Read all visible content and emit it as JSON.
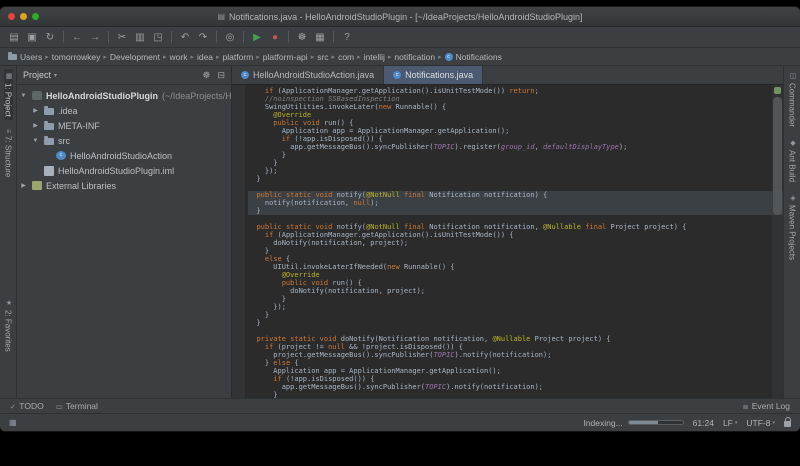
{
  "window": {
    "title": "Notifications.java - HelloAndroidStudioPlugin - [~/IdeaProjects/HelloAndroidStudioPlugin]",
    "doc_icon_glyph": "▤"
  },
  "colors": {
    "keyword": "#cc7832",
    "annotation": "#bbb529",
    "comment": "#808080",
    "field": "#9876aa",
    "text": "#a9b7c6",
    "active_tab": "#4b5a70",
    "editor_bg": "#2b2b2b"
  },
  "toolbar": {
    "items": [
      {
        "name": "open-icon",
        "glyph": "▤"
      },
      {
        "name": "save-all-icon",
        "glyph": "▣"
      },
      {
        "name": "synchronize-icon",
        "glyph": "↻"
      },
      {
        "sep": true
      },
      {
        "name": "back-icon",
        "glyph": "←"
      },
      {
        "name": "forward-icon",
        "glyph": "→"
      },
      {
        "sep": true
      },
      {
        "name": "cut-icon",
        "glyph": "✂"
      },
      {
        "name": "copy-icon",
        "glyph": "▥"
      },
      {
        "name": "paste-icon",
        "glyph": "◳"
      },
      {
        "sep": true
      },
      {
        "name": "undo-icon",
        "glyph": "↶"
      },
      {
        "name": "redo-icon",
        "glyph": "↷"
      },
      {
        "sep": true
      },
      {
        "name": "find-icon",
        "glyph": "◎"
      },
      {
        "sep": true
      },
      {
        "name": "run-icon",
        "glyph": "▶",
        "color": "#499c54"
      },
      {
        "name": "debug-icon",
        "glyph": "●",
        "color": "#c75450"
      },
      {
        "sep": true
      },
      {
        "name": "settings-icon",
        "glyph": "☸"
      },
      {
        "name": "project-structure-icon",
        "glyph": "▦"
      },
      {
        "sep": true
      },
      {
        "name": "help-icon",
        "glyph": "?"
      }
    ]
  },
  "navbar": {
    "separator": "▸",
    "crumbs": [
      "Users",
      "tomorrowkey",
      "Development",
      "work",
      "idea",
      "platform",
      "platform-api",
      "src",
      "com",
      "intellij",
      "notification",
      "Notifications"
    ]
  },
  "tabs": [
    {
      "label": "HelloAndroidStudioAction.java",
      "active": false
    },
    {
      "label": "Notifications.java",
      "active": true
    }
  ],
  "left_stripe": [
    {
      "name": "tool-button-project",
      "label": "1: Project",
      "glyph": "▦",
      "active": true
    },
    {
      "name": "tool-button-structure",
      "label": "7: Structure",
      "glyph": "≡"
    },
    {
      "name": "tool-button-favorites",
      "label": "2: Favorites",
      "glyph": "★",
      "gap_before": 110
    }
  ],
  "right_stripe": [
    {
      "name": "tool-button-commander",
      "label": "Commander",
      "glyph": "◫"
    },
    {
      "name": "tool-button-ant-build",
      "label": "Ant Build",
      "glyph": "◆"
    },
    {
      "name": "tool-button-maven-projects",
      "label": "Maven Projects",
      "glyph": "◈"
    }
  ],
  "project_panel": {
    "header": "Project",
    "header_caret": "▾",
    "header_icons": [
      {
        "name": "gear-icon",
        "glyph": "☸"
      },
      {
        "name": "collapse-all-icon",
        "glyph": "⊟"
      }
    ],
    "tree": [
      {
        "level": 0,
        "chevron": "▼",
        "icon": "project",
        "label": "HelloAndroidStudioPlugin",
        "suffix": " (~/IdeaProjects/Hello",
        "bold": true
      },
      {
        "level": 1,
        "chevron": "▶",
        "icon": "folder",
        "label": ".idea"
      },
      {
        "level": 1,
        "chevron": "▶",
        "icon": "folder",
        "label": "META-INF"
      },
      {
        "level": 1,
        "chevron": "▼",
        "icon": "folder",
        "label": "src"
      },
      {
        "level": 2,
        "chevron": "",
        "icon": "class",
        "label": "HelloAndroidStudioAction"
      },
      {
        "level": 1,
        "chevron": "",
        "icon": "file",
        "label": "HelloAndroidStudioPlugin.iml"
      },
      {
        "level": 0,
        "chevron": "▶",
        "icon": "library",
        "label": "External Libraries"
      }
    ]
  },
  "bottom_stripe": {
    "left": [
      {
        "name": "tool-button-todo",
        "icon_name": "todo-icon",
        "glyph": "✓",
        "label": "TODO"
      },
      {
        "name": "tool-button-terminal",
        "icon_name": "terminal-icon",
        "glyph": "▭",
        "label": "Terminal"
      }
    ],
    "right": [
      {
        "name": "tool-button-event-log",
        "icon_name": "event-log-icon",
        "glyph": "≣",
        "label": "Event Log"
      }
    ]
  },
  "status_bar": {
    "quick_access_glyph": "▦",
    "indexing_label": "Indexing...",
    "progress_percent": 55,
    "caret_position": "61:24",
    "line_ending": "LF",
    "encoding": "UTF-8",
    "caret_glyph": "▾"
  },
  "editor": {
    "lines": [
      {
        "t": [
          [
            "d",
            "    "
          ],
          [
            "k",
            "if"
          ],
          [
            "d",
            " (ApplicationManager.getApplication().isUnitTestMode()) "
          ],
          [
            "k",
            "return"
          ],
          [
            "d",
            ";"
          ]
        ]
      },
      {
        "t": [
          [
            "c",
            "    //noinspection SSBasedInspection"
          ]
        ]
      },
      {
        "t": [
          [
            "d",
            "    SwingUtilities.invokeLater("
          ],
          [
            "k",
            "new"
          ],
          [
            "d",
            " Runnable() {"
          ]
        ]
      },
      {
        "t": [
          [
            "d",
            "      "
          ],
          [
            "a",
            "@Override"
          ]
        ]
      },
      {
        "t": [
          [
            "d",
            "      "
          ],
          [
            "k",
            "public"
          ],
          [
            "d",
            " "
          ],
          [
            "k",
            "void"
          ],
          [
            "d",
            " run() {"
          ]
        ]
      },
      {
        "t": [
          [
            "d",
            "        Application app = ApplicationManager.getApplication();"
          ]
        ]
      },
      {
        "t": [
          [
            "d",
            "        "
          ],
          [
            "k",
            "if"
          ],
          [
            "d",
            " (!app.isDisposed()) {"
          ]
        ]
      },
      {
        "t": [
          [
            "d",
            "          app.getMessageBus().syncPublisher("
          ],
          [
            "f",
            "TOPIC"
          ],
          [
            "d",
            ").register("
          ],
          [
            "f",
            "group_id"
          ],
          [
            "d",
            ", "
          ],
          [
            "f",
            "defaultDisplayType"
          ],
          [
            "d",
            ");"
          ]
        ]
      },
      {
        "t": [
          [
            "d",
            "        }"
          ]
        ]
      },
      {
        "t": [
          [
            "d",
            "      }"
          ]
        ]
      },
      {
        "t": [
          [
            "d",
            "    });"
          ]
        ]
      },
      {
        "t": [
          [
            "d",
            "  }"
          ]
        ]
      },
      {
        "t": []
      },
      {
        "hl": true,
        "t": [
          [
            "d",
            "  "
          ],
          [
            "k",
            "public static void"
          ],
          [
            "d",
            " notify("
          ],
          [
            "a",
            "@NotNull"
          ],
          [
            "d",
            " "
          ],
          [
            "k",
            "final"
          ],
          [
            "d",
            " Notification notification) {"
          ]
        ]
      },
      {
        "hl": true,
        "t": [
          [
            "d",
            "    notify(notification, "
          ],
          [
            "k",
            "null"
          ],
          [
            "d",
            ");"
          ]
        ]
      },
      {
        "hl": true,
        "t": [
          [
            "d",
            "  }"
          ]
        ]
      },
      {
        "t": []
      },
      {
        "t": [
          [
            "d",
            "  "
          ],
          [
            "k",
            "public static void"
          ],
          [
            "d",
            " notify("
          ],
          [
            "a",
            "@NotNull"
          ],
          [
            "d",
            " "
          ],
          [
            "k",
            "final"
          ],
          [
            "d",
            " Notification notification, "
          ],
          [
            "a",
            "@Nullable"
          ],
          [
            "d",
            " "
          ],
          [
            "k",
            "final"
          ],
          [
            "d",
            " Project project) {"
          ]
        ]
      },
      {
        "t": [
          [
            "d",
            "    "
          ],
          [
            "k",
            "if"
          ],
          [
            "d",
            " (ApplicationManager.getApplication().isUnitTestMode()) {"
          ]
        ]
      },
      {
        "t": [
          [
            "d",
            "      doNotify(notification, project);"
          ]
        ]
      },
      {
        "t": [
          [
            "d",
            "    }"
          ]
        ]
      },
      {
        "t": [
          [
            "d",
            "    "
          ],
          [
            "k",
            "else"
          ],
          [
            "d",
            " {"
          ]
        ]
      },
      {
        "t": [
          [
            "d",
            "      UIUtil.invokeLaterIfNeeded("
          ],
          [
            "k",
            "new"
          ],
          [
            "d",
            " Runnable() {"
          ]
        ]
      },
      {
        "t": [
          [
            "d",
            "        "
          ],
          [
            "a",
            "@Override"
          ]
        ]
      },
      {
        "t": [
          [
            "d",
            "        "
          ],
          [
            "k",
            "public"
          ],
          [
            "d",
            " "
          ],
          [
            "k",
            "void"
          ],
          [
            "d",
            " run() {"
          ]
        ]
      },
      {
        "t": [
          [
            "d",
            "          doNotify(notification, project);"
          ]
        ]
      },
      {
        "t": [
          [
            "d",
            "        }"
          ]
        ]
      },
      {
        "t": [
          [
            "d",
            "      });"
          ]
        ]
      },
      {
        "t": [
          [
            "d",
            "    }"
          ]
        ]
      },
      {
        "t": [
          [
            "d",
            "  }"
          ]
        ]
      },
      {
        "t": []
      },
      {
        "t": [
          [
            "d",
            "  "
          ],
          [
            "k",
            "private static void"
          ],
          [
            "d",
            " doNotify(Notification notification, "
          ],
          [
            "a",
            "@Nullable"
          ],
          [
            "d",
            " Project project) {"
          ]
        ]
      },
      {
        "t": [
          [
            "d",
            "    "
          ],
          [
            "k",
            "if"
          ],
          [
            "d",
            " (project != "
          ],
          [
            "k",
            "null"
          ],
          [
            "d",
            " && !project.isDisposed()) {"
          ]
        ]
      },
      {
        "t": [
          [
            "d",
            "      project.getMessageBus().syncPublisher("
          ],
          [
            "f",
            "TOPIC"
          ],
          [
            "d",
            ").notify(notification);"
          ]
        ]
      },
      {
        "t": [
          [
            "d",
            "    } "
          ],
          [
            "k",
            "else"
          ],
          [
            "d",
            " {"
          ]
        ]
      },
      {
        "t": [
          [
            "d",
            "      Application app = ApplicationManager.getApplication();"
          ]
        ]
      },
      {
        "t": [
          [
            "d",
            "      "
          ],
          [
            "k",
            "if"
          ],
          [
            "d",
            " (!app.isDisposed()) {"
          ]
        ]
      },
      {
        "t": [
          [
            "d",
            "        app.getMessageBus().syncPublisher("
          ],
          [
            "f",
            "TOPIC"
          ],
          [
            "d",
            ").notify(notification);"
          ]
        ]
      },
      {
        "t": [
          [
            "d",
            "      }"
          ]
        ]
      },
      {
        "t": [
          [
            "d",
            "    }"
          ]
        ]
      }
    ]
  }
}
